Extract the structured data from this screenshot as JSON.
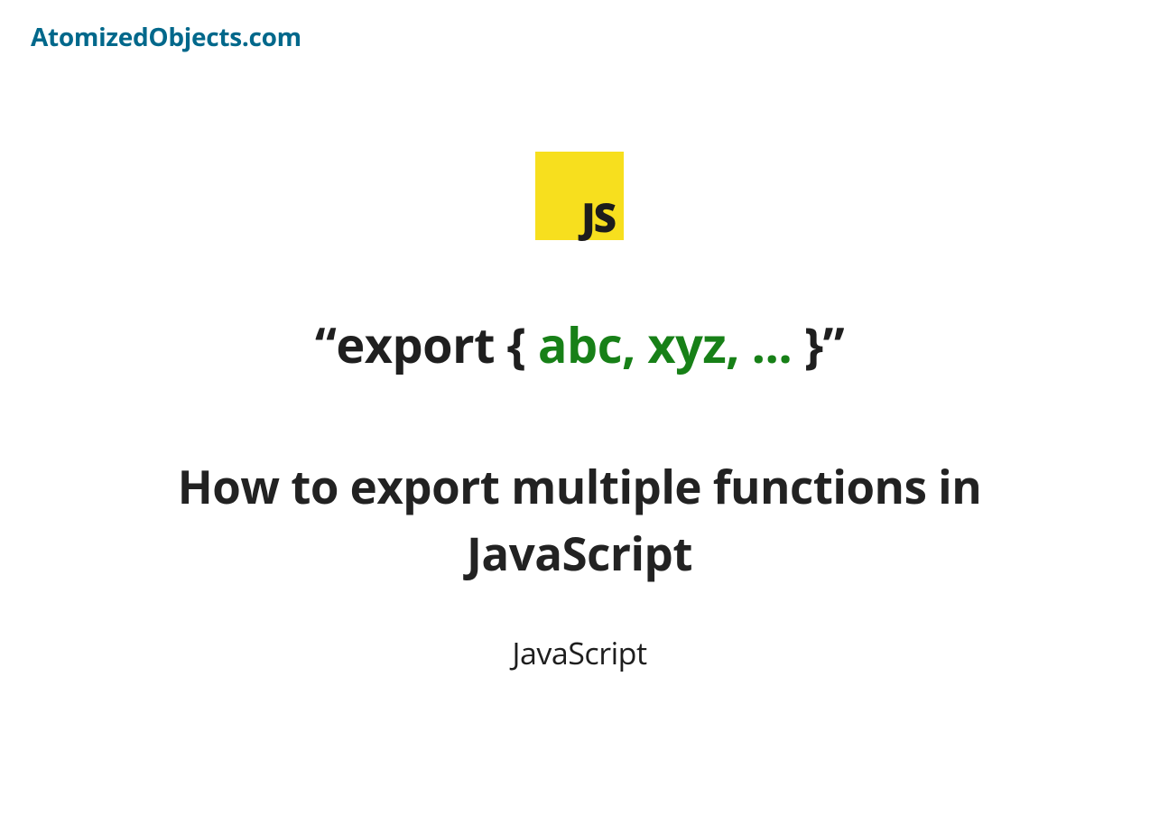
{
  "brand": "AtomizedObjects.com",
  "badge": {
    "text": "JS"
  },
  "snippet": {
    "prefix": "“export { ",
    "highlight": "abc, xyz, ...",
    "suffix": " }”"
  },
  "title": "How to export multiple functions in JavaScript",
  "category": "JavaScript"
}
